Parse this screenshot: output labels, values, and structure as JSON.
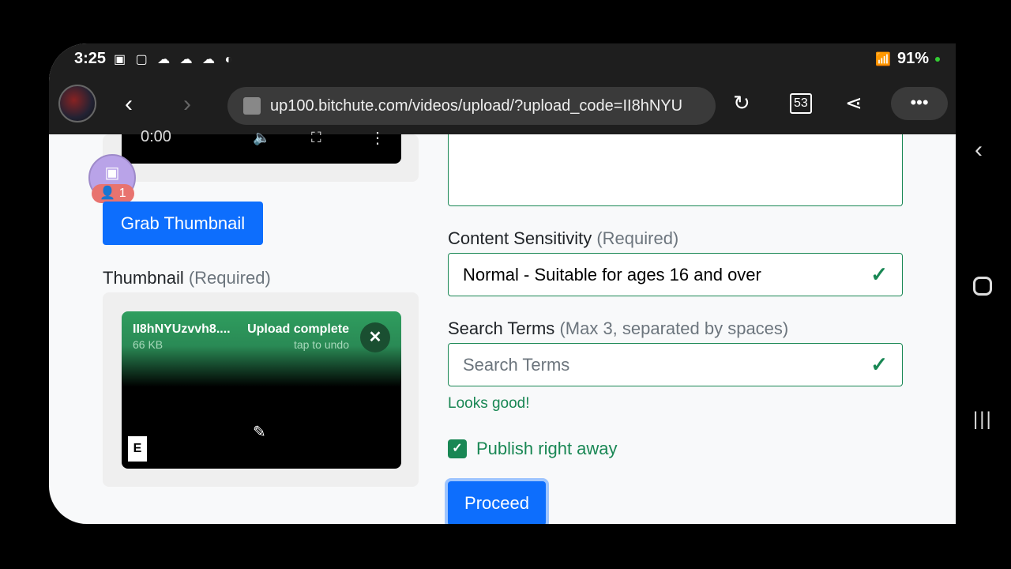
{
  "status": {
    "time": "3:25",
    "notification_icons": "twitch-icon cast-icon cloud-icon cloud-upload-icon cloud-icon vpn-icon",
    "battery": "91%"
  },
  "browser": {
    "url": "up100.bitchute.com/videos/upload/?upload_code=II8hNYU",
    "tab_count": "53",
    "back": "‹",
    "forward": "›",
    "more": "•••"
  },
  "left": {
    "twitch_badge": "1",
    "grab_thumbnail": "Grab Thumbnail",
    "video_time": "0:00",
    "thumbnail_label": "Thumbnail",
    "thumbnail_req": "(Required)",
    "upload": {
      "filename": "II8hNYUzvvh8....",
      "size": "66 KB",
      "status": "Upload complete",
      "undo": "tap to undo"
    }
  },
  "right": {
    "sensitivity_label": "Content Sensitivity",
    "sensitivity_req": "(Required)",
    "sensitivity_value": "Normal - Suitable for ages 16 and over",
    "search_label": "Search Terms",
    "search_hint": "(Max 3, separated by spaces)",
    "search_placeholder": "Search Terms",
    "valid_msg": "Looks good!",
    "publish_label": "Publish right away",
    "publish_checked": true,
    "proceed": "Proceed"
  },
  "colors": {
    "primary": "#0d6efd",
    "success": "#198754",
    "upload_green": "#2f9e5f"
  }
}
